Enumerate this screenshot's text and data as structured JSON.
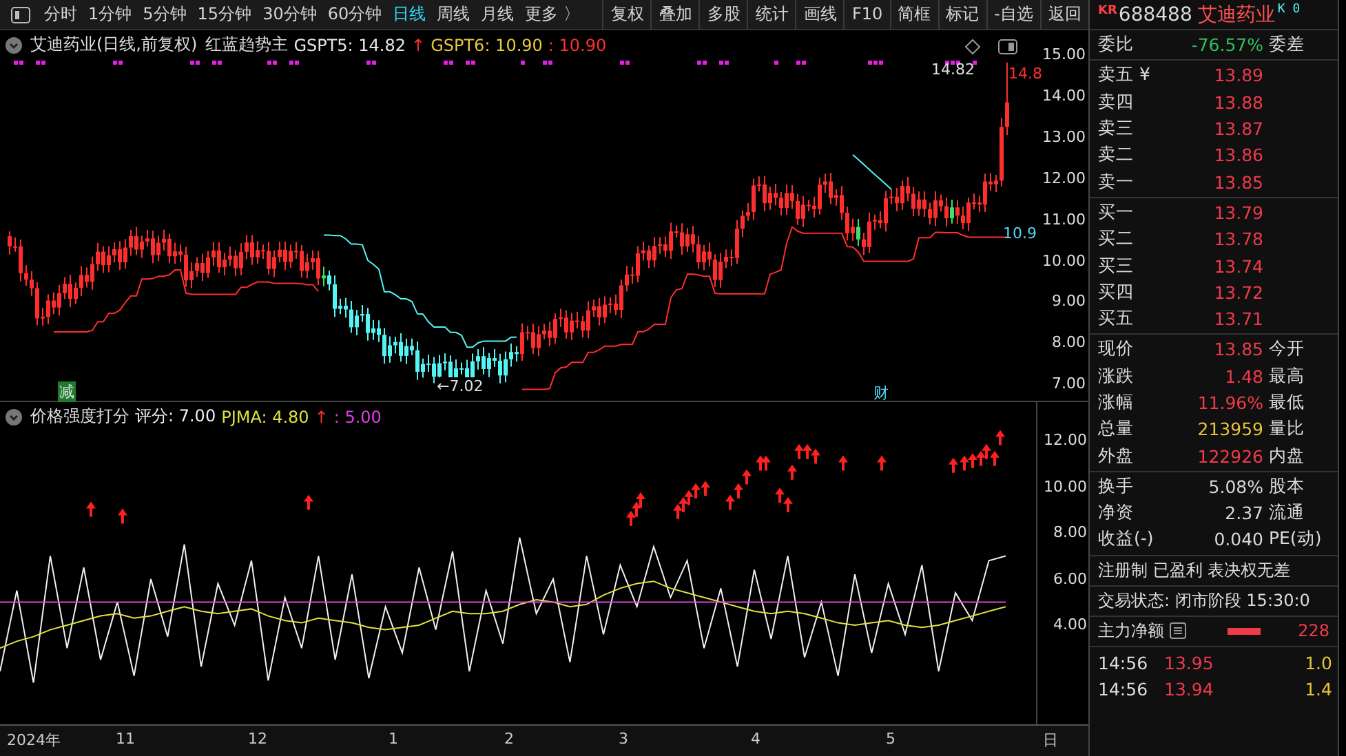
{
  "toolbar": {
    "periods": [
      {
        "label": "分时",
        "selected": false
      },
      {
        "label": "1分钟",
        "selected": false
      },
      {
        "label": "5分钟",
        "selected": false
      },
      {
        "label": "15分钟",
        "selected": false
      },
      {
        "label": "30分钟",
        "selected": false
      },
      {
        "label": "60分钟",
        "selected": false
      },
      {
        "label": "日线",
        "selected": true
      },
      {
        "label": "周线",
        "selected": false
      },
      {
        "label": "月线",
        "selected": false
      },
      {
        "label": "更多 〉",
        "selected": false
      }
    ],
    "buttons": [
      "复权",
      "叠加",
      "多股",
      "统计",
      "画线",
      "F10",
      "简框",
      "标记",
      "-自选",
      "返回"
    ]
  },
  "main_chart": {
    "title": "艾迪药业(日线,前复权)",
    "indicator": "红蓝趋势主",
    "legend": [
      {
        "text": "GSPT5: 14.82",
        "color": "#e6e6e6"
      },
      {
        "text": "↑",
        "color": "#ff3030"
      },
      {
        "text": "GSPT6: 10.90",
        "color": "#e8c840"
      },
      {
        "text": ": 10.90",
        "color": "#ff3030"
      }
    ],
    "y_axis": [
      "15.00",
      "14.00",
      "13.00",
      "12.00",
      "11.00",
      "10.00",
      "9.00",
      "8.00",
      "7.00"
    ],
    "marks": [
      {
        "kind": "high",
        "text": "14.82"
      },
      {
        "kind": "low",
        "text": "←7.02"
      },
      {
        "kind": "level",
        "text": "10.9"
      },
      {
        "kind": "edge",
        "text": "14.8"
      },
      {
        "kind": "tag_green",
        "text": "减"
      },
      {
        "kind": "tag_cyan",
        "text": "财"
      }
    ]
  },
  "score_chart": {
    "title": "价格强度打分",
    "legend": [
      {
        "kind": "series",
        "text": ": 7.00"
      },
      {
        "kind": "series",
        "text": ": 4.80"
      },
      {
        "kind": "plain",
        "text": "↑",
        "color": "#ff3030"
      },
      {
        "kind": "series",
        "text": ": 5.00"
      }
    ],
    "chart_data": {
      "type": "line",
      "yticks": [
        {
          "value": 12,
          "label": "12.00"
        },
        {
          "value": 10,
          "label": "10.00"
        },
        {
          "value": 8,
          "label": "8.00"
        },
        {
          "value": 6,
          "label": "6.00"
        },
        {
          "value": 4,
          "label": "4.00"
        }
      ],
      "ylim": [
        -0.3,
        13.67
      ],
      "series": [
        {
          "name": "评分",
          "color": "#f0f0f0",
          "values": [
            2.0,
            5.5,
            1.5,
            7.0,
            3.0,
            6.5,
            2.5,
            5.0,
            1.8,
            6.0,
            3.5,
            7.5,
            2.2,
            5.8,
            4.0,
            6.8,
            1.6,
            5.2,
            3.0,
            7.0,
            2.5,
            6.2,
            1.7,
            4.8,
            2.8,
            6.5,
            3.8,
            7.2,
            2.0,
            5.5,
            3.2,
            7.8,
            4.5,
            6.0,
            2.4,
            7.0,
            3.6,
            6.6,
            4.8,
            7.4,
            5.2,
            6.8,
            3.0,
            5.6,
            2.2,
            6.4,
            3.4,
            7.0,
            2.6,
            5.0,
            1.8,
            6.2,
            2.8,
            5.8,
            3.6,
            6.6,
            2.0,
            5.4,
            4.2,
            6.8,
            7.0
          ]
        },
        {
          "name": "PJMA",
          "color": "#e0e040",
          "values": [
            3.0,
            3.3,
            3.5,
            3.8,
            4.0,
            4.2,
            4.4,
            4.5,
            4.3,
            4.4,
            4.6,
            4.8,
            4.6,
            4.5,
            4.6,
            4.7,
            4.4,
            4.2,
            4.1,
            4.3,
            4.2,
            4.1,
            3.9,
            3.8,
            3.9,
            4.0,
            4.3,
            4.6,
            4.5,
            4.5,
            4.6,
            4.9,
            5.1,
            5.0,
            4.8,
            4.9,
            5.3,
            5.6,
            5.8,
            5.9,
            5.6,
            5.4,
            5.2,
            5.0,
            4.8,
            4.6,
            4.5,
            4.6,
            4.5,
            4.3,
            4.1,
            4.0,
            4.1,
            4.2,
            4.0,
            3.9,
            4.0,
            4.2,
            4.4,
            4.6,
            4.8
          ]
        },
        {
          "color": "#e040e0",
          "values": [
            5,
            5,
            5,
            5,
            5,
            5,
            5,
            5,
            5,
            5,
            5,
            5,
            5,
            5,
            5,
            5,
            5,
            5,
            5,
            5,
            5,
            5,
            5,
            5,
            5,
            5,
            5,
            5,
            5,
            5,
            5,
            5,
            5,
            5,
            5,
            5,
            5,
            5,
            5,
            5,
            5,
            5,
            5,
            5,
            5,
            5,
            5,
            5,
            5,
            5,
            5,
            5,
            5,
            5,
            5,
            5,
            5,
            5,
            5,
            5,
            5
          ]
        }
      ]
    }
  },
  "x_axis": [
    "2024年",
    "11",
    "12",
    "1",
    "2",
    "3",
    "4",
    "5",
    "日"
  ],
  "quote": {
    "market": "KR",
    "code": "688488",
    "name": "艾迪药业",
    "flags": "K 0",
    "ratio": {
      "label": "委比",
      "value": "-76.57%",
      "color": "#2fbf5f",
      "label2": "委差"
    },
    "asks": [
      {
        "label": "卖五 ¥",
        "price": "13.89"
      },
      {
        "label": "卖四",
        "price": "13.88"
      },
      {
        "label": "卖三",
        "price": "13.87"
      },
      {
        "label": "卖二",
        "price": "13.86"
      },
      {
        "label": "卖一",
        "price": "13.85"
      }
    ],
    "bids": [
      {
        "label": "买一",
        "price": "13.79"
      },
      {
        "label": "买二",
        "price": "13.78"
      },
      {
        "label": "买三",
        "price": "13.74"
      },
      {
        "label": "买四",
        "price": "13.72"
      },
      {
        "label": "买五",
        "price": "13.71"
      }
    ],
    "stats": [
      {
        "label": "现价",
        "value": "13.85",
        "color": "#f03a4a",
        "label2": "今开"
      },
      {
        "label": "涨跌",
        "value": "1.48",
        "color": "#f03a4a",
        "label2": "最高"
      },
      {
        "label": "涨幅",
        "value": "11.96%",
        "color": "#f03a4a",
        "label2": "最低"
      },
      {
        "label": "总量",
        "value": "213959",
        "color": "#e8c33a",
        "label2": "量比"
      },
      {
        "label": "外盘",
        "value": "122926",
        "color": "#f03a4a",
        "label2": "内盘"
      }
    ],
    "finance": [
      {
        "label": "换手",
        "value": "5.08%",
        "color": "#d8d8d8",
        "label2": "股本"
      },
      {
        "label": "净资",
        "value": "2.37",
        "color": "#d8d8d8",
        "label2": "流通"
      },
      {
        "label": "收益(-)",
        "value": "0.040",
        "color": "#d8d8d8",
        "label2": "PE(动)"
      }
    ],
    "tags": "注册制 已盈利 表决权无差",
    "status": "交易状态: 闭市阶段 15:30:0",
    "net_flow": {
      "label": "主力净额",
      "value": "228"
    },
    "trades": [
      {
        "time": "14:56",
        "price": "13.95",
        "volume": "1.0"
      },
      {
        "time": "14:56",
        "price": "13.94",
        "volume": "1.4"
      }
    ]
  }
}
